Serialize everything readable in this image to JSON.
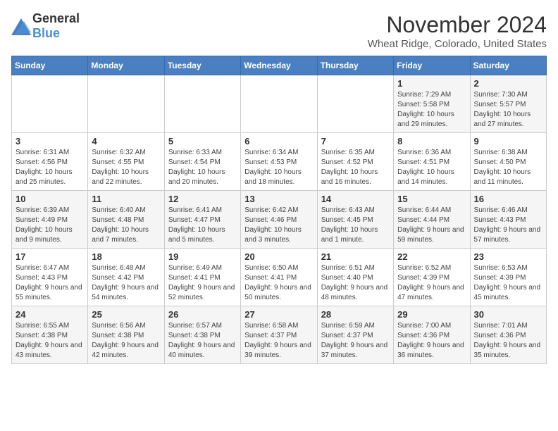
{
  "header": {
    "logo_general": "General",
    "logo_blue": "Blue",
    "month_title": "November 2024",
    "location": "Wheat Ridge, Colorado, United States"
  },
  "days_of_week": [
    "Sunday",
    "Monday",
    "Tuesday",
    "Wednesday",
    "Thursday",
    "Friday",
    "Saturday"
  ],
  "weeks": [
    [
      {
        "day": "",
        "content": ""
      },
      {
        "day": "",
        "content": ""
      },
      {
        "day": "",
        "content": ""
      },
      {
        "day": "",
        "content": ""
      },
      {
        "day": "",
        "content": ""
      },
      {
        "day": "1",
        "content": "Sunrise: 7:29 AM\nSunset: 5:58 PM\nDaylight: 10 hours and 29 minutes."
      },
      {
        "day": "2",
        "content": "Sunrise: 7:30 AM\nSunset: 5:57 PM\nDaylight: 10 hours and 27 minutes."
      }
    ],
    [
      {
        "day": "3",
        "content": "Sunrise: 6:31 AM\nSunset: 4:56 PM\nDaylight: 10 hours and 25 minutes."
      },
      {
        "day": "4",
        "content": "Sunrise: 6:32 AM\nSunset: 4:55 PM\nDaylight: 10 hours and 22 minutes."
      },
      {
        "day": "5",
        "content": "Sunrise: 6:33 AM\nSunset: 4:54 PM\nDaylight: 10 hours and 20 minutes."
      },
      {
        "day": "6",
        "content": "Sunrise: 6:34 AM\nSunset: 4:53 PM\nDaylight: 10 hours and 18 minutes."
      },
      {
        "day": "7",
        "content": "Sunrise: 6:35 AM\nSunset: 4:52 PM\nDaylight: 10 hours and 16 minutes."
      },
      {
        "day": "8",
        "content": "Sunrise: 6:36 AM\nSunset: 4:51 PM\nDaylight: 10 hours and 14 minutes."
      },
      {
        "day": "9",
        "content": "Sunrise: 6:38 AM\nSunset: 4:50 PM\nDaylight: 10 hours and 11 minutes."
      }
    ],
    [
      {
        "day": "10",
        "content": "Sunrise: 6:39 AM\nSunset: 4:49 PM\nDaylight: 10 hours and 9 minutes."
      },
      {
        "day": "11",
        "content": "Sunrise: 6:40 AM\nSunset: 4:48 PM\nDaylight: 10 hours and 7 minutes."
      },
      {
        "day": "12",
        "content": "Sunrise: 6:41 AM\nSunset: 4:47 PM\nDaylight: 10 hours and 5 minutes."
      },
      {
        "day": "13",
        "content": "Sunrise: 6:42 AM\nSunset: 4:46 PM\nDaylight: 10 hours and 3 minutes."
      },
      {
        "day": "14",
        "content": "Sunrise: 6:43 AM\nSunset: 4:45 PM\nDaylight: 10 hours and 1 minute."
      },
      {
        "day": "15",
        "content": "Sunrise: 6:44 AM\nSunset: 4:44 PM\nDaylight: 9 hours and 59 minutes."
      },
      {
        "day": "16",
        "content": "Sunrise: 6:46 AM\nSunset: 4:43 PM\nDaylight: 9 hours and 57 minutes."
      }
    ],
    [
      {
        "day": "17",
        "content": "Sunrise: 6:47 AM\nSunset: 4:43 PM\nDaylight: 9 hours and 55 minutes."
      },
      {
        "day": "18",
        "content": "Sunrise: 6:48 AM\nSunset: 4:42 PM\nDaylight: 9 hours and 54 minutes."
      },
      {
        "day": "19",
        "content": "Sunrise: 6:49 AM\nSunset: 4:41 PM\nDaylight: 9 hours and 52 minutes."
      },
      {
        "day": "20",
        "content": "Sunrise: 6:50 AM\nSunset: 4:41 PM\nDaylight: 9 hours and 50 minutes."
      },
      {
        "day": "21",
        "content": "Sunrise: 6:51 AM\nSunset: 4:40 PM\nDaylight: 9 hours and 48 minutes."
      },
      {
        "day": "22",
        "content": "Sunrise: 6:52 AM\nSunset: 4:39 PM\nDaylight: 9 hours and 47 minutes."
      },
      {
        "day": "23",
        "content": "Sunrise: 6:53 AM\nSunset: 4:39 PM\nDaylight: 9 hours and 45 minutes."
      }
    ],
    [
      {
        "day": "24",
        "content": "Sunrise: 6:55 AM\nSunset: 4:38 PM\nDaylight: 9 hours and 43 minutes."
      },
      {
        "day": "25",
        "content": "Sunrise: 6:56 AM\nSunset: 4:38 PM\nDaylight: 9 hours and 42 minutes."
      },
      {
        "day": "26",
        "content": "Sunrise: 6:57 AM\nSunset: 4:38 PM\nDaylight: 9 hours and 40 minutes."
      },
      {
        "day": "27",
        "content": "Sunrise: 6:58 AM\nSunset: 4:37 PM\nDaylight: 9 hours and 39 minutes."
      },
      {
        "day": "28",
        "content": "Sunrise: 6:59 AM\nSunset: 4:37 PM\nDaylight: 9 hours and 37 minutes."
      },
      {
        "day": "29",
        "content": "Sunrise: 7:00 AM\nSunset: 4:36 PM\nDaylight: 9 hours and 36 minutes."
      },
      {
        "day": "30",
        "content": "Sunrise: 7:01 AM\nSunset: 4:36 PM\nDaylight: 9 hours and 35 minutes."
      }
    ]
  ]
}
